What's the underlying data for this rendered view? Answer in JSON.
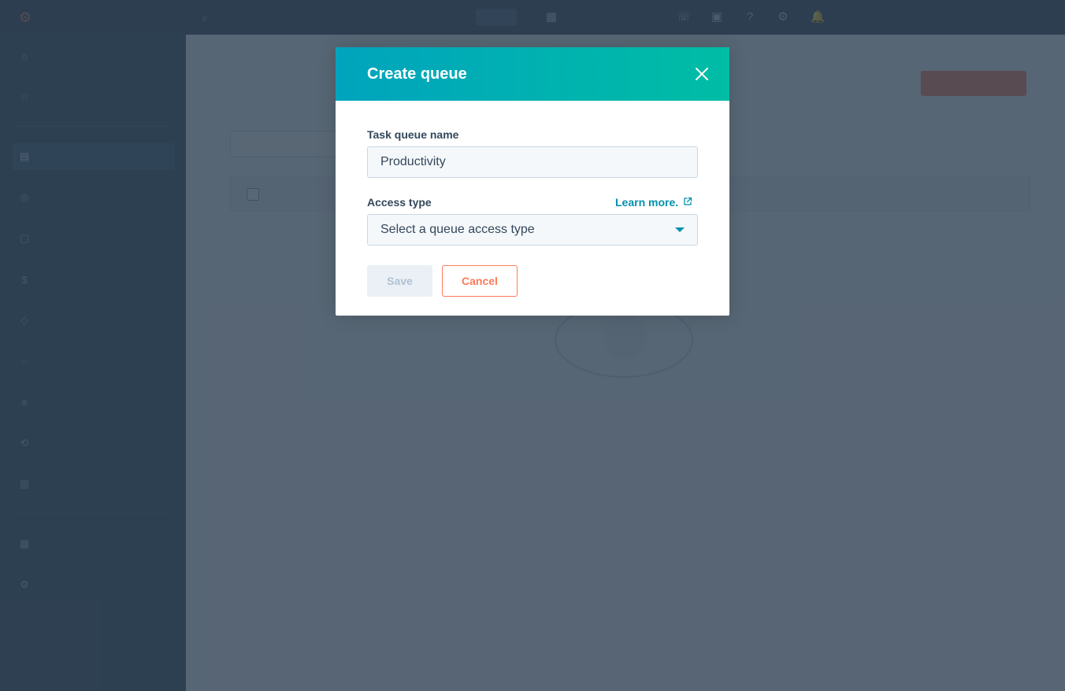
{
  "colors": {
    "modal_header_start": "#00a4bd",
    "modal_header_end": "#00bda5",
    "link": "#0091ae",
    "cancel": "#ff7a59",
    "overlay": "#2d3e50"
  },
  "modal": {
    "title": "Create queue",
    "close_icon": "close-icon",
    "name_label": "Task queue name",
    "name_value": "Productivity",
    "access_label": "Access type",
    "learn_more": "Learn more.",
    "learn_more_icon": "external-link-icon",
    "access_placeholder": "Select a queue access type",
    "save_label": "Save",
    "cancel_label": "Cancel"
  }
}
